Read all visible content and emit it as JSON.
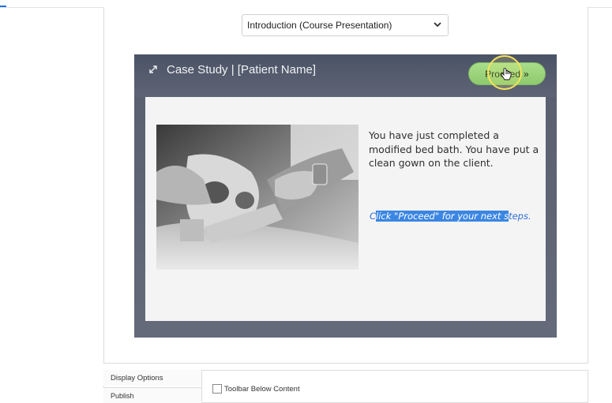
{
  "select": {
    "value": "Introduction (Course Presentation)",
    "icon": "chevron-down-icon"
  },
  "presentation": {
    "title": "Case Study | [Patient Name]",
    "proceed_label": "Proceed",
    "proceed_icon": "double-chevron-right-icon",
    "expand_icon": "expand-icon",
    "slide": {
      "body_text": "You have just completed a modified bed bath.  You have put a clean gown on the client.",
      "cta_prefix": "C",
      "cta_selected": "lick \"Proceed\" for your next s",
      "cta_suffix": "teps.",
      "image_desc_icon": "patient-care-photo"
    }
  },
  "display_options": {
    "tab_label": "Display Options",
    "publish_label": "Publish",
    "toolbar_below_label": "Toolbar Below Content",
    "toolbar_below_checked": false
  },
  "colors": {
    "accent_blue": "#1a73e8",
    "proceed_green": "#9ed47e",
    "selection_blue": "#3b86e3",
    "frame_slate": "#555c6d"
  }
}
